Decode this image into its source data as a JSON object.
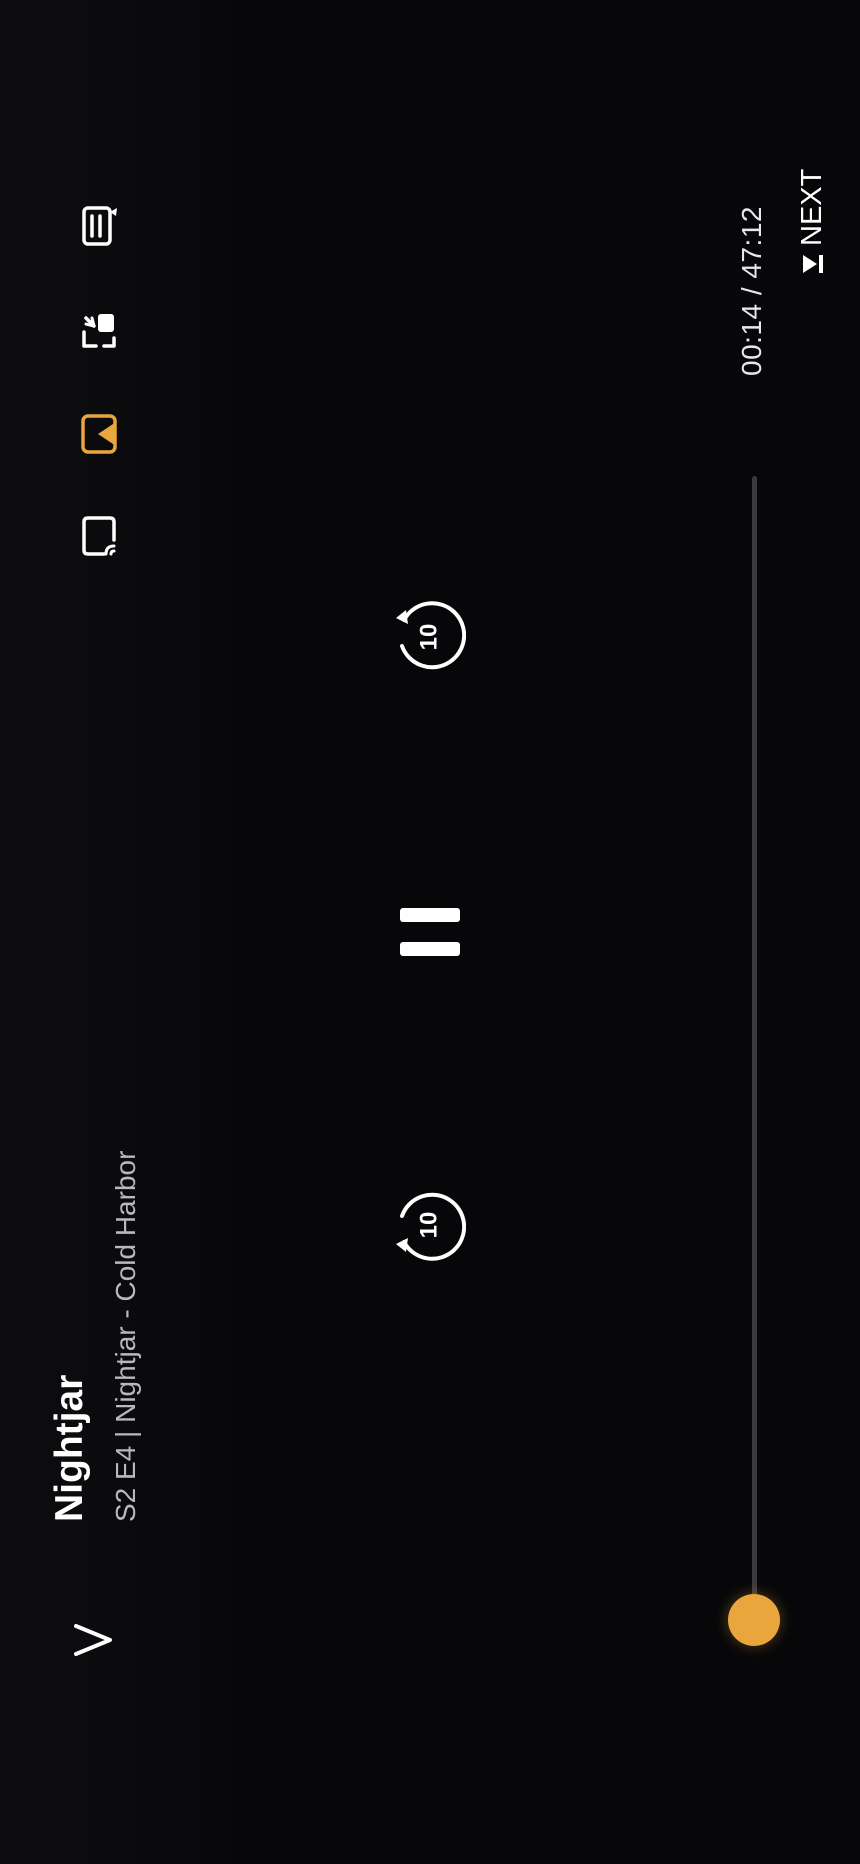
{
  "player": {
    "title": "Nightjar",
    "subtitle": "S2 E4 | Nightjar - Cold Harbor",
    "time": "00:14 / 47:12",
    "next_label": "NEXT",
    "progress_fraction": 0.005,
    "skip_seconds": "10"
  },
  "icons": {
    "collapse": "chevron-down-icon",
    "episodes": "episodes-list-icon",
    "pip": "picture-in-picture-icon",
    "playback_mode": "video-file-play-icon",
    "cast": "cast-icon"
  },
  "colors": {
    "accent": "#e9a63c",
    "background": "#070709",
    "track": "#3a3a3e"
  }
}
